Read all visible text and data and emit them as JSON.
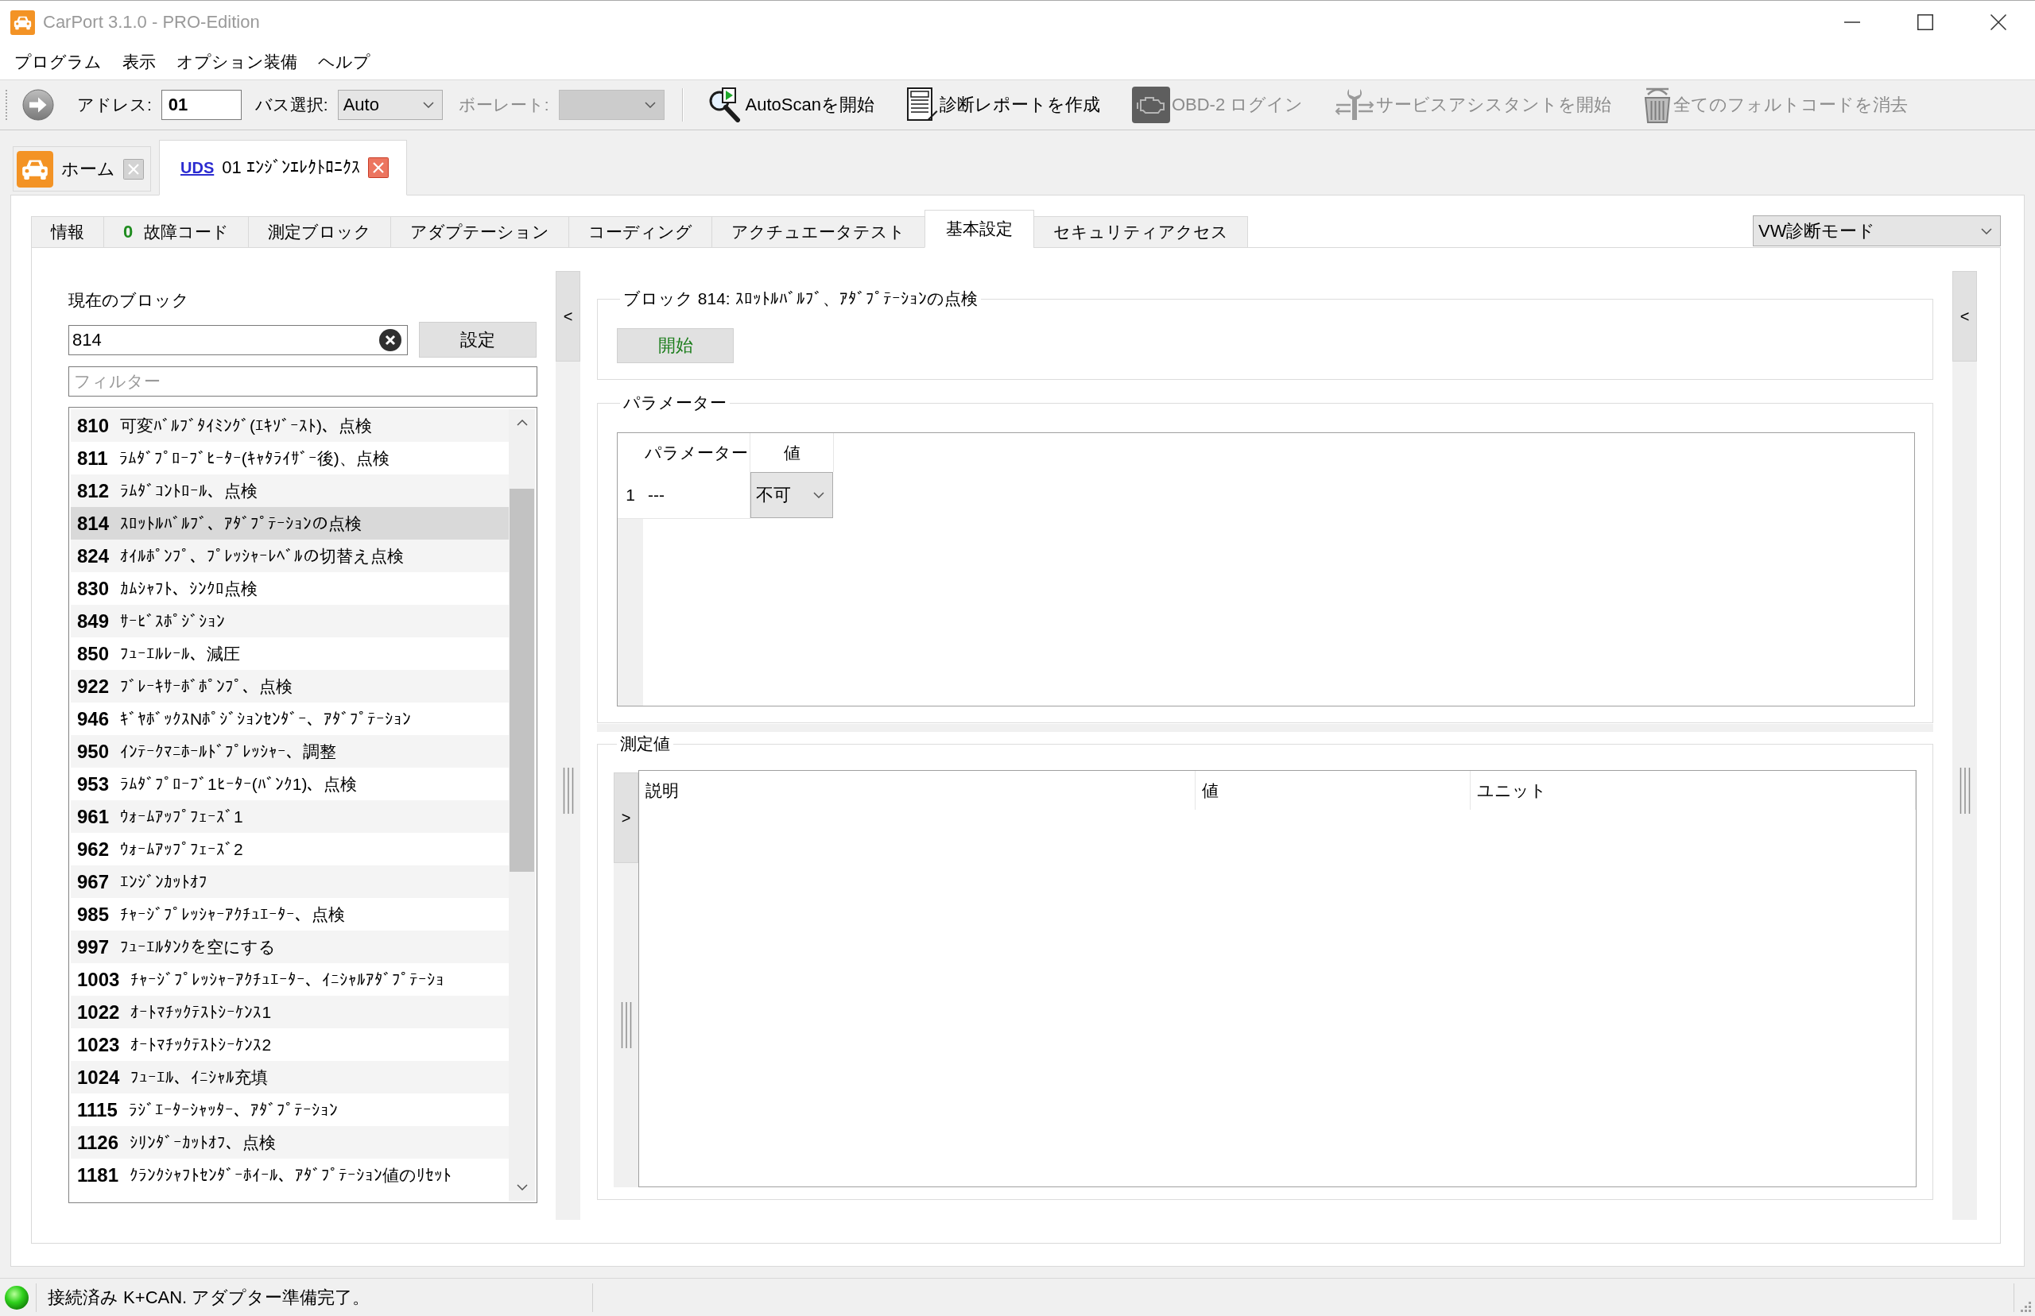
{
  "window": {
    "title": "CarPort 3.1.0 - PRO-Edition"
  },
  "menu": [
    "プログラム",
    "表示",
    "オプション装備",
    "ヘルプ"
  ],
  "toolbar": {
    "address": {
      "label": "アドレス:",
      "value": "01"
    },
    "bus": {
      "label": "バス選択:",
      "value": "Auto"
    },
    "baud": {
      "label": "ボーレート:",
      "disabled": true
    },
    "actions": [
      {
        "kind": "autoscan",
        "label": "AutoScanを開始",
        "disabled": false
      },
      {
        "kind": "report",
        "label": "診断レポートを作成",
        "disabled": false
      },
      {
        "kind": "obd",
        "label": "OBD-2 ログイン",
        "disabled": true
      },
      {
        "kind": "service",
        "label": "サービスアシスタントを開始",
        "disabled": true
      },
      {
        "kind": "clear",
        "label": "全てのフォルトコードを消去",
        "disabled": true
      }
    ]
  },
  "document_tabs": [
    {
      "kind": "home",
      "label": "ホーム",
      "selected": false
    },
    {
      "kind": "module",
      "protocol": "UDS",
      "label": "01 ｴﾝｼﾞﾝｴﾚｸﾄﾛﾆｸｽ",
      "selected": true
    }
  ],
  "module_tabs": [
    {
      "label": "情報",
      "selected": false
    },
    {
      "count": "0",
      "label": "故障コード",
      "selected": false
    },
    {
      "label": "測定ブロック",
      "selected": false
    },
    {
      "label": "アダプテーション",
      "selected": false
    },
    {
      "label": "コーディング",
      "selected": false
    },
    {
      "label": "アクチュエータテスト",
      "selected": false
    },
    {
      "label": "基本設定",
      "selected": true
    },
    {
      "label": "セキュリティアクセス",
      "selected": false
    }
  ],
  "mode_select": {
    "value": "VW診断モード"
  },
  "block_selector": {
    "label": "現在のブロック",
    "value": "814",
    "set_button": "設定",
    "filter_placeholder": "フィルター",
    "items": [
      {
        "number": "810",
        "name": "可変ﾊﾞﾙﾌﾞﾀｲﾐﾝｸﾞ(ｴｷｿﾞｰｽﾄ)、点検",
        "selected": false
      },
      {
        "number": "811",
        "name": "ﾗﾑﾀﾞﾌﾟﾛｰﾌﾞﾋｰﾀｰ(ｷｬﾀﾗｲｻﾞｰ後)、点検",
        "selected": false
      },
      {
        "number": "812",
        "name": "ﾗﾑﾀﾞｺﾝﾄﾛｰﾙ、点検",
        "selected": false
      },
      {
        "number": "814",
        "name": "ｽﾛｯﾄﾙﾊﾞﾙﾌﾞ、ｱﾀﾞﾌﾟﾃｰｼｮﾝの点検",
        "selected": true
      },
      {
        "number": "824",
        "name": "ｵｲﾙﾎﾟﾝﾌﾟ、ﾌﾟﾚｯｼｬｰﾚﾍﾞﾙの切替え点検",
        "selected": false
      },
      {
        "number": "830",
        "name": "ｶﾑｼｬﾌﾄ、ｼﾝｸﾛ点検",
        "selected": false
      },
      {
        "number": "849",
        "name": "ｻｰﾋﾞｽﾎﾟｼﾞｼｮﾝ",
        "selected": false
      },
      {
        "number": "850",
        "name": "ﾌｭｰｴﾙﾚｰﾙ、減圧",
        "selected": false
      },
      {
        "number": "922",
        "name": "ﾌﾞﾚｰｷｻｰﾎﾞﾎﾟﾝﾌﾟ、点検",
        "selected": false
      },
      {
        "number": "946",
        "name": "ｷﾞﾔﾎﾞｯｸｽNﾎﾟｼﾞｼｮﾝｾﾝﾀﾞｰ、ｱﾀﾞﾌﾟﾃｰｼｮﾝ",
        "selected": false
      },
      {
        "number": "950",
        "name": "ｲﾝﾃｰｸﾏﾆﾎｰﾙﾄﾞﾌﾟﾚｯｼｬｰ、調整",
        "selected": false
      },
      {
        "number": "953",
        "name": "ﾗﾑﾀﾞﾌﾟﾛｰﾌﾞ1ﾋｰﾀｰ(ﾊﾞﾝｸ1)、点検",
        "selected": false
      },
      {
        "number": "961",
        "name": "ｳｫｰﾑｱｯﾌﾟﾌｪｰｽﾞ1",
        "selected": false
      },
      {
        "number": "962",
        "name": "ｳｫｰﾑｱｯﾌﾟﾌｪｰｽﾞ2",
        "selected": false
      },
      {
        "number": "967",
        "name": "ｴﾝｼﾞﾝｶｯﾄｵﾌ",
        "selected": false
      },
      {
        "number": "985",
        "name": "ﾁｬｰｼﾞﾌﾟﾚｯｼｬｰｱｸﾁｭｴｰﾀｰ、点検",
        "selected": false
      },
      {
        "number": "997",
        "name": "ﾌｭｰｴﾙﾀﾝｸを空にする",
        "selected": false
      },
      {
        "number": "1003",
        "name": "ﾁｬｰｼﾞﾌﾟﾚｯｼｬｰｱｸﾁｭｴｰﾀｰ、ｲﾆｼｬﾙｱﾀﾞﾌﾟﾃｰｼｮ",
        "selected": false
      },
      {
        "number": "1022",
        "name": "ｵｰﾄﾏﾁｯｸﾃｽﾄｼｰｹﾝｽ1",
        "selected": false
      },
      {
        "number": "1023",
        "name": "ｵｰﾄﾏﾁｯｸﾃｽﾄｼｰｹﾝｽ2",
        "selected": false
      },
      {
        "number": "1024",
        "name": "ﾌｭｰｴﾙ、ｲﾆｼｬﾙ充填",
        "selected": false
      },
      {
        "number": "1115",
        "name": "ﾗｼﾞｴｰﾀｰｼｬｯﾀｰ、ｱﾀﾞﾌﾟﾃｰｼｮﾝ",
        "selected": false
      },
      {
        "number": "1126",
        "name": "ｼﾘﾝﾀﾞｰｶｯﾄｵﾌ、点検",
        "selected": false
      },
      {
        "number": "1181",
        "name": "ｸﾗﾝｸｼｬﾌﾄｾﾝﾀﾞｰﾎｲｰﾙ、ｱﾀﾞﾌﾟﾃｰｼｮﾝ値のﾘｾｯﾄ",
        "selected": false
      }
    ]
  },
  "left_pane_toggle": "<",
  "block_group": {
    "title": "ブロック 814: ｽﾛｯﾄﾙﾊﾞﾙﾌﾞ、ｱﾀﾞﾌﾟﾃｰｼｮﾝの点検",
    "start_button": "開始"
  },
  "parameters": {
    "title": "パラメーター",
    "columns": [
      "パラメーター",
      "値"
    ],
    "rows": [
      {
        "index": "1",
        "parameter": "---",
        "value": "不可"
      }
    ]
  },
  "measurements": {
    "title": "測定値",
    "toggle": ">",
    "columns": [
      "説明",
      "値",
      "ユニット"
    ]
  },
  "right_pane_toggle": "<",
  "status_bar": {
    "connected": true,
    "text": "接続済み K+CAN. アダプター準備完了。"
  }
}
